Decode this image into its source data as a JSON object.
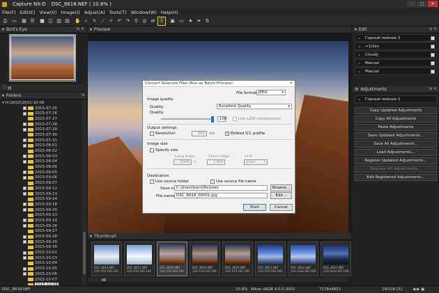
{
  "window": {
    "app": "Capture NX-D",
    "doc": "DSC_8618.NEF ( 10.8% )"
  },
  "menu": [
    "File(F)",
    "Edit(E)",
    "View(V)",
    "Image(I)",
    "Adjust(A)",
    "Tools(T)",
    "Window(W)",
    "Help(H)"
  ],
  "left": {
    "birds_eye_title": "Bird's Eye",
    "folders_title": "Folders",
    "drive": "H:\\2015\\2015-10-08",
    "folders": [
      "2015-07-25",
      "2015-07-26",
      "2015-07-27",
      "2015-07-28",
      "2015-07-29",
      "2015-07-30",
      "2015-07-31",
      "2015-08-01",
      "2015-08-02",
      "2015-08-03",
      "2015-08-04",
      "2015-08-05",
      "2015-09-05",
      "2015-09-06",
      "2015-09-07",
      "2015-09-12",
      "2015-09-13",
      "2015-09-14",
      "2015-09-18",
      "2015-09-20",
      "2015-09-23",
      "2015-09-24",
      "2015-09-26",
      "2015-09-27",
      "2015-09-28",
      "2015-09-29",
      "2015-09-30",
      "2015-10-01",
      "2015-10-03",
      "2015-10-04",
      "2015-10-05",
      "2015-10-06",
      "2015-10-07",
      "2015-10-08",
      "2015-10-09",
      "2015-10-10"
    ],
    "selected_folder": "2015-10-08"
  },
  "center": {
    "preview_title": "Preview",
    "thumbnail_title": "Thumbnail"
  },
  "thumbs": [
    {
      "cap1": "DSC_8614.NEF",
      "cap2": "1/4s f/16 ISO 100"
    },
    {
      "cap1": "DSC_8615.NEF",
      "cap2": "1/4s f/16 ISO 100"
    },
    {
      "cap1": "DSC_8618.NEF",
      "cap2": "1/4s f/16 ISO 100"
    },
    {
      "cap1": "DSC_8619.NEF",
      "cap2": "1/4s f/16 ISO 100"
    },
    {
      "cap1": "DSC_8620.NEF",
      "cap2": "1/4s f/16 ISO 100"
    },
    {
      "cap1": "DSC_8621.NEF",
      "cap2": "1/4s f/16 ISO 100"
    },
    {
      "cap1": "DSC_8622.NEF",
      "cap2": "1/5s Auto ISO 100"
    },
    {
      "cap1": "DSC_8623.NEF",
      "cap2": "1/5s Auto ISO 100"
    }
  ],
  "right": {
    "edit_title": "Edit",
    "edit_rows": [
      "Горный пейзаж 1",
      "+1/2ev",
      "Cloudy",
      "Manual",
      "Manual"
    ],
    "adjustments_title": "Adjustments",
    "adj_current": "Горный пейзаж 1",
    "adj_buttons": [
      "Copy Updated Adjustments",
      "Copy All Adjustments",
      "Paste Adjustments",
      "Save Updated Adjustments...",
      "Save All Adjustments...",
      "Load Adjustments...",
      "Register Updated Adjustments...",
      "Register All Adjustments...",
      "Edit Registered Adjustments..."
    ]
  },
  "status": {
    "file": "DSC_8618.NEF",
    "zoom": "10.8%",
    "profile": "Nikon sRGB 4.0.0.3002",
    "size": "7278x4852",
    "page": "19/316 [3]"
  },
  "dialog": {
    "title": "Convert Selected Files (Run as Batch Process)",
    "file_format_label": "File format:",
    "file_format": "JPEG",
    "image_quality": "Image quality",
    "quality_label": "Quality",
    "quality_value": "Excellent Quality",
    "quality_label2": "Quality",
    "quality_num": "100",
    "use_lzw": "Use LZW compression",
    "output_settings": "Output settings",
    "resolution_label": "Resolution",
    "resolution": "300",
    "dpi": "dpi",
    "embed_icc": "Embed ICC profile",
    "image_size": "Image size",
    "specify_size": "Specify size",
    "long_edge": "Long edge",
    "short_edge": "Short edge",
    "unit": "Unit",
    "long_val": "2040",
    "short_val": "1360",
    "unit_val": "pixel",
    "times": "x",
    "destination": "Destination",
    "use_source_folder": "Use source folder",
    "use_source_name": "Use source file name",
    "save_in_label": "Save in:",
    "save_in": "C:\\Users\\karri\\Pictures",
    "browse": "Browse...",
    "file_name_label": "File name:",
    "file_name": "DSC_8618_00001.jpg",
    "edit": "Edit...",
    "start": "Start",
    "cancel": "Cancel"
  }
}
